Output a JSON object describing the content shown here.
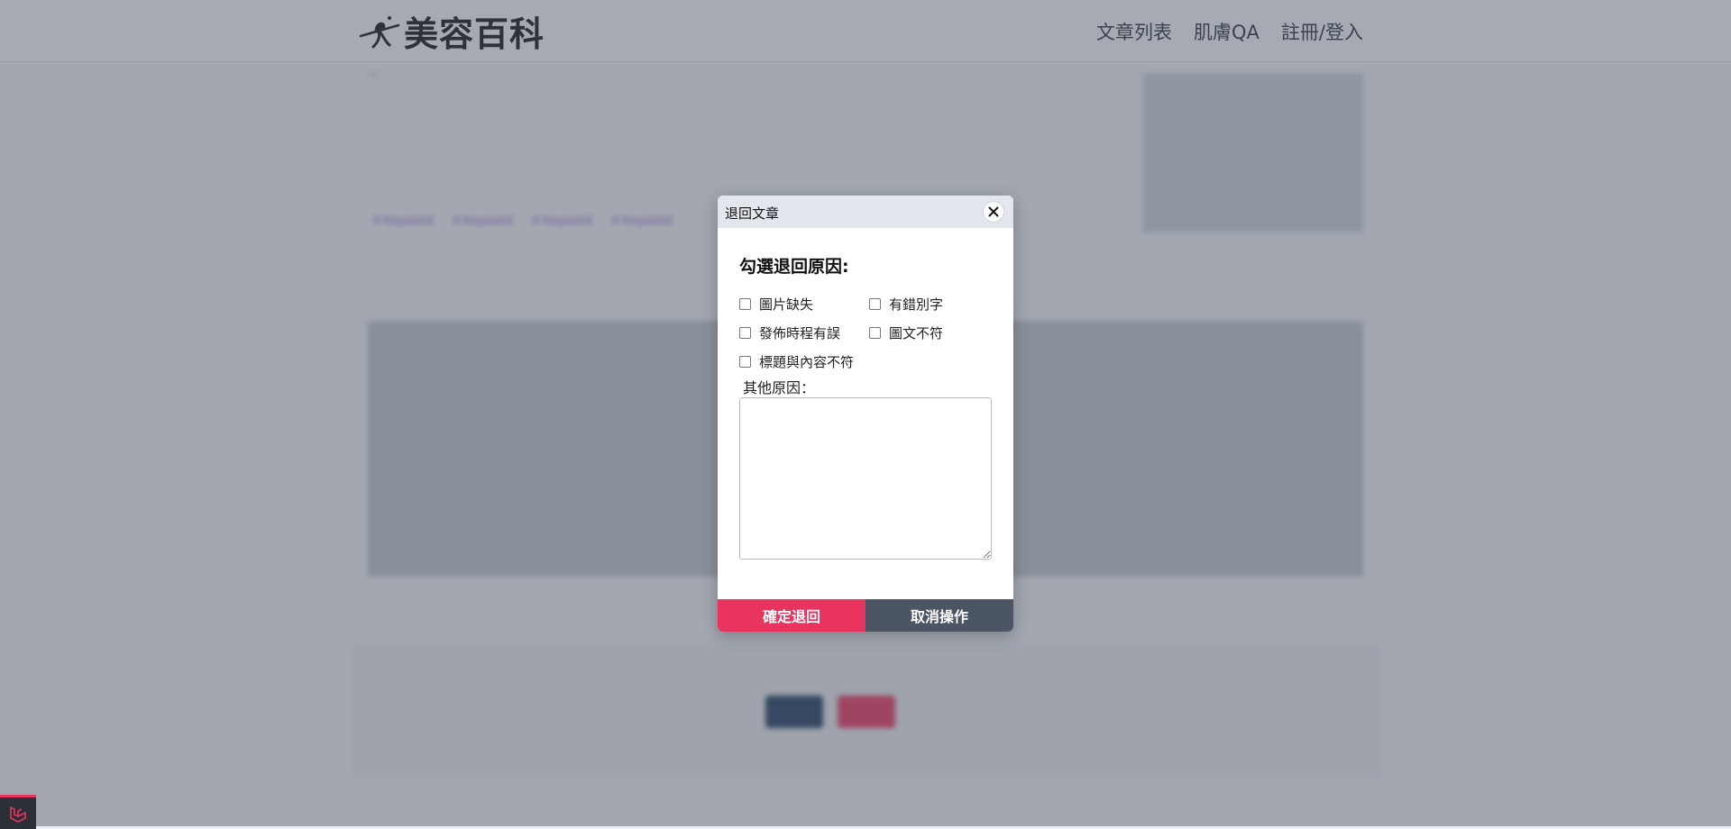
{
  "header": {
    "brand_name": "美容百科",
    "nav": [
      "文章列表",
      "肌膚QA",
      "註冊/登入"
    ]
  },
  "background": {
    "paragraph": "...",
    "ad_label": "",
    "keywords": [
      "# Keyword",
      "# Keyword",
      "# Keyword",
      "# Keyword"
    ],
    "section_title": "",
    "footer_buttons": [
      "",
      ""
    ],
    "footer_info": [
      "",
      ""
    ]
  },
  "modal": {
    "title": "退回文章",
    "heading": "勾選退回原因:",
    "reasons": [
      "圖片缺失",
      "有錯別字",
      "發佈時程有誤",
      "圖文不符",
      "標題與內容不符"
    ],
    "other_label": "其他原因：",
    "other_value": "",
    "confirm_label": "確定退回",
    "cancel_label": "取消操作"
  },
  "colors": {
    "accent": "#e8345f",
    "cancel": "#4b5563",
    "header_bg": "#f5f6f7"
  }
}
